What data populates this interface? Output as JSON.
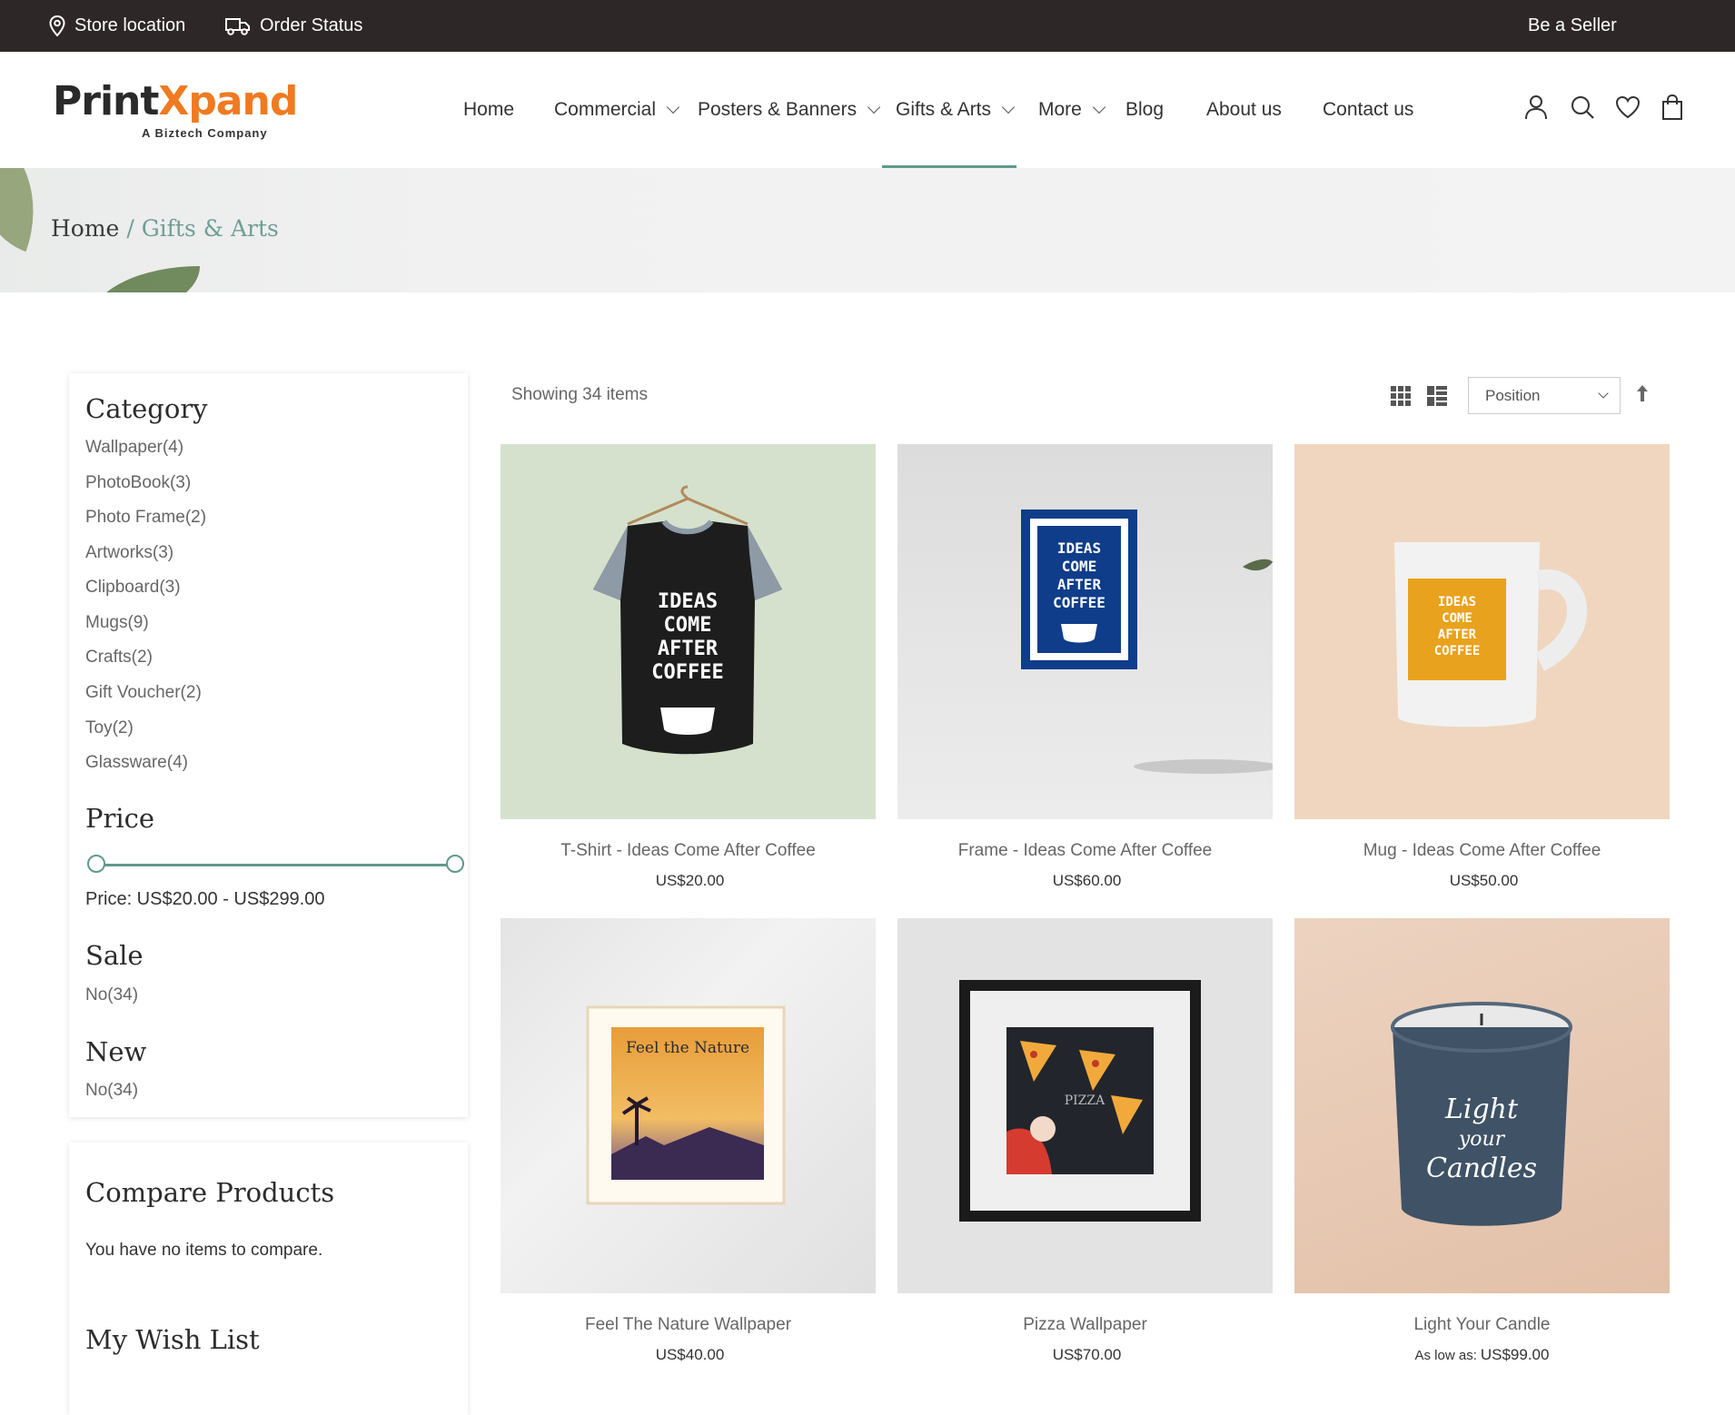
{
  "topbar": {
    "store_location": "Store location",
    "order_status": "Order Status",
    "be_seller": "Be a Seller"
  },
  "logo": {
    "part1": "Print",
    "part2": "Xpand",
    "tagline": "A Biztech Company"
  },
  "nav": {
    "items": [
      "Home",
      "Commercial",
      "Posters & Banners",
      "Gifts & Arts",
      "More",
      "Blog",
      "About us",
      "Contact us"
    ],
    "active": "Gifts & Arts"
  },
  "breadcrumb": {
    "home": "Home",
    "separator": "/",
    "current": "Gifts & Arts"
  },
  "sidebar": {
    "category_title": "Category",
    "categories": [
      "Wallpaper(4)",
      "PhotoBook(3)",
      "Photo Frame(2)",
      "Artworks(3)",
      "Clipboard(3)",
      "Mugs(9)",
      "Crafts(2)",
      "Gift Voucher(2)",
      "Toy(2)",
      "Glassware(4)"
    ],
    "price_title": "Price",
    "price_range_text": "Price: US$20.00 - US$299.00",
    "price_min_fraction": 0.0,
    "price_max_fraction": 1.0,
    "sale_title": "Sale",
    "sale_option": "No(34)",
    "new_title": "New",
    "new_option": "No(34)",
    "compare_title": "Compare Products",
    "compare_text": "You have no items to compare.",
    "wishlist_title": "My Wish List"
  },
  "toolbar": {
    "showing": "Showing 34 items",
    "sort_selected": "Position"
  },
  "products": [
    {
      "name": "T-Shirt - Ideas Come After Coffee",
      "price": "US$20.00",
      "price_prefix": ""
    },
    {
      "name": "Frame - Ideas Come After Coffee",
      "price": "US$60.00",
      "price_prefix": ""
    },
    {
      "name": "Mug - Ideas Come After Coffee",
      "price": "US$50.00",
      "price_prefix": ""
    },
    {
      "name": "Feel The Nature Wallpaper",
      "price": "US$40.00",
      "price_prefix": ""
    },
    {
      "name": "Pizza Wallpaper",
      "price": "US$70.00",
      "price_prefix": ""
    },
    {
      "name": "Light Your Candle",
      "price": "US$99.00",
      "price_prefix": "As low as:"
    }
  ],
  "artwork": {
    "coffee_text": "IDEAS COME AFTER COFFEE",
    "nature_text": "Feel the Nature",
    "pizza_text": "PIZZA",
    "candle_text": "Light your Candles"
  },
  "colors": {
    "topbar_bg": "#2e2727",
    "accent": "#5f9a8d",
    "logo_orange": "#ef7a22"
  }
}
